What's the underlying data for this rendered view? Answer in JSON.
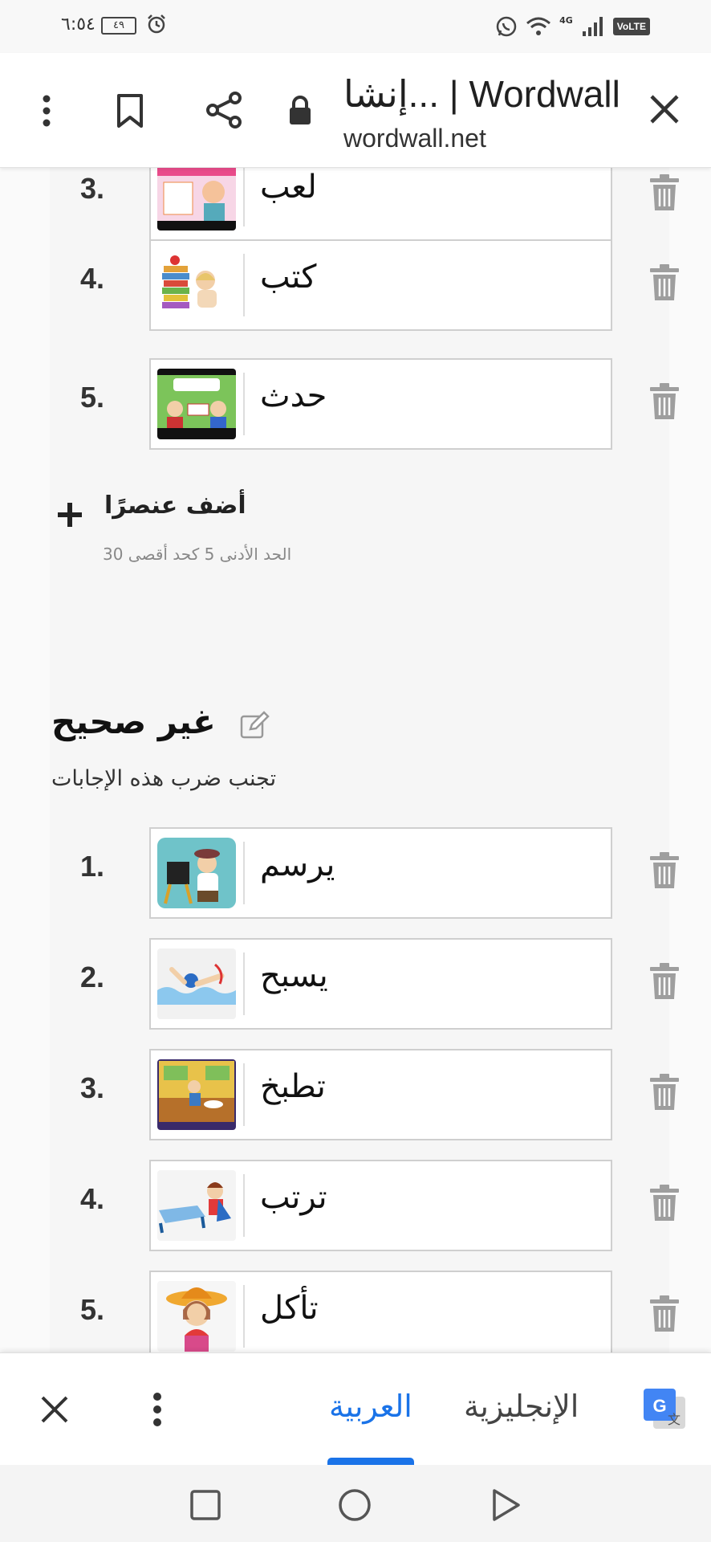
{
  "status_bar": {
    "time": "٦:٥٤",
    "battery": "٤٩",
    "network": "4G",
    "volte": "VoLTE"
  },
  "browser": {
    "title": "إنشا... | Wordwall",
    "url": "wordwall.net"
  },
  "correct_list": {
    "items": [
      {
        "number": "3.",
        "word": "لعب",
        "thumb": "toy-store-video"
      },
      {
        "number": "4.",
        "word": "كتب",
        "thumb": "girl-with-books"
      },
      {
        "number": "5.",
        "word": "حدث",
        "thumb": "school-story-video"
      }
    ]
  },
  "add_item": {
    "label": "أضف عنصرًا",
    "limit": "الحد الأدنى 5 كحد أقصى 30"
  },
  "incorrect_section": {
    "title": "غير صحيح",
    "subtitle": "تجنب ضرب هذه الإجابات",
    "items": [
      {
        "number": "1.",
        "word": "يرسم",
        "thumb": "painter"
      },
      {
        "number": "2.",
        "word": "يسبح",
        "thumb": "swimmer"
      },
      {
        "number": "3.",
        "word": "تطبخ",
        "thumb": "kitchen"
      },
      {
        "number": "4.",
        "word": "ترتب",
        "thumb": "bed-making"
      },
      {
        "number": "5.",
        "word": "تأكل",
        "thumb": "girl-eating"
      }
    ]
  },
  "translate_bar": {
    "source_lang": "الإنجليزية",
    "target_lang": "العربية"
  },
  "colors": {
    "accent": "#1a73e8",
    "border": "#cfcfcf",
    "icon_gray": "#9e9e9e"
  }
}
